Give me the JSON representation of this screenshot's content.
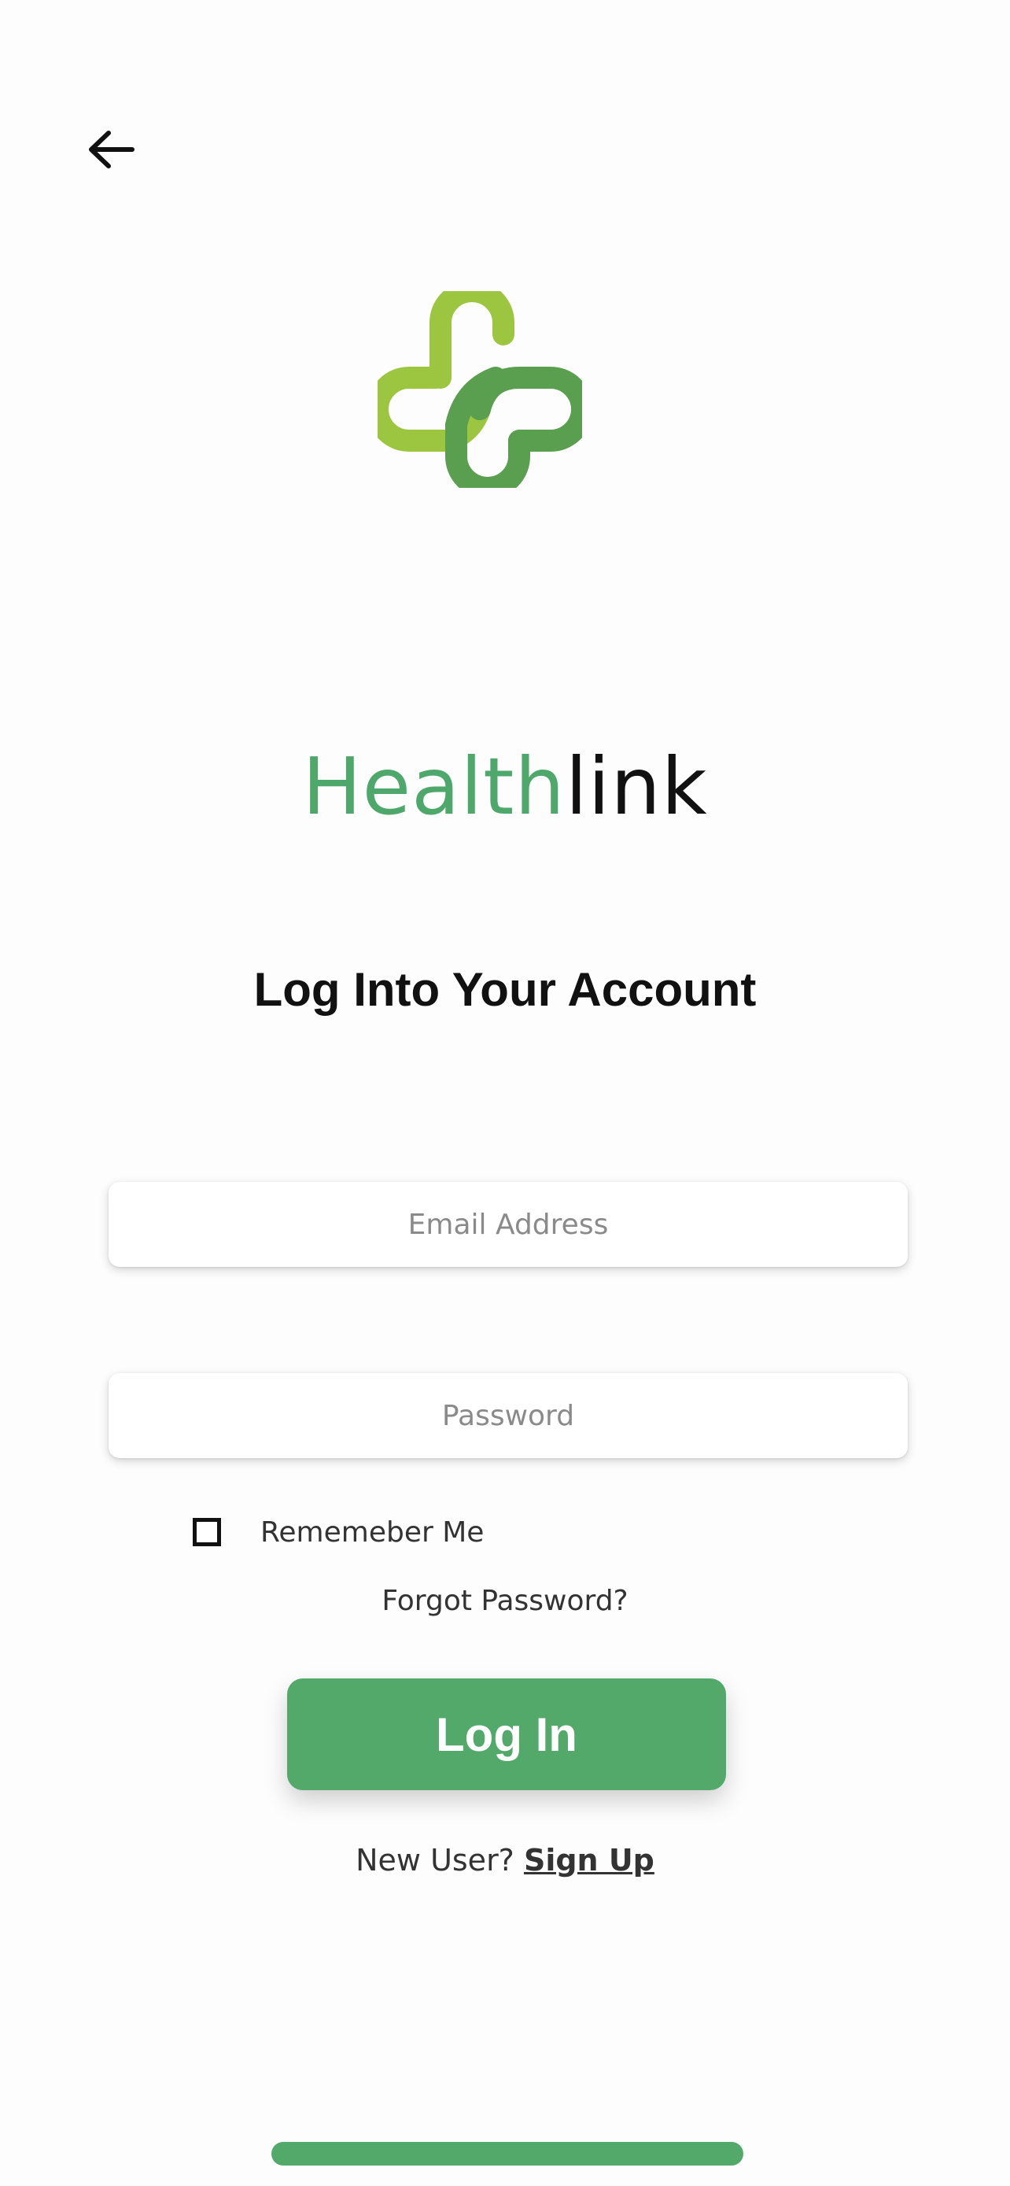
{
  "brand": {
    "name_part1": "Health",
    "name_part2": "link",
    "logo_icon": "medical-cross-logo-icon"
  },
  "nav": {
    "back_icon": "arrow-left-icon"
  },
  "title": "Log Into Your Account",
  "form": {
    "email": {
      "placeholder": "Email Address",
      "value": ""
    },
    "password": {
      "placeholder": "Password",
      "value": ""
    },
    "remember_label": "Rememeber Me",
    "remember_checked": false,
    "forgot_label": "Forgot Password?",
    "login_label": "Log In"
  },
  "signup": {
    "prompt": "New User?",
    "link_label": "Sign Up"
  },
  "colors": {
    "brand_green": "#52a96a",
    "logo_light_green": "#9cc63f",
    "logo_dark_green": "#5a9e4f",
    "text_dark": "#111111"
  }
}
